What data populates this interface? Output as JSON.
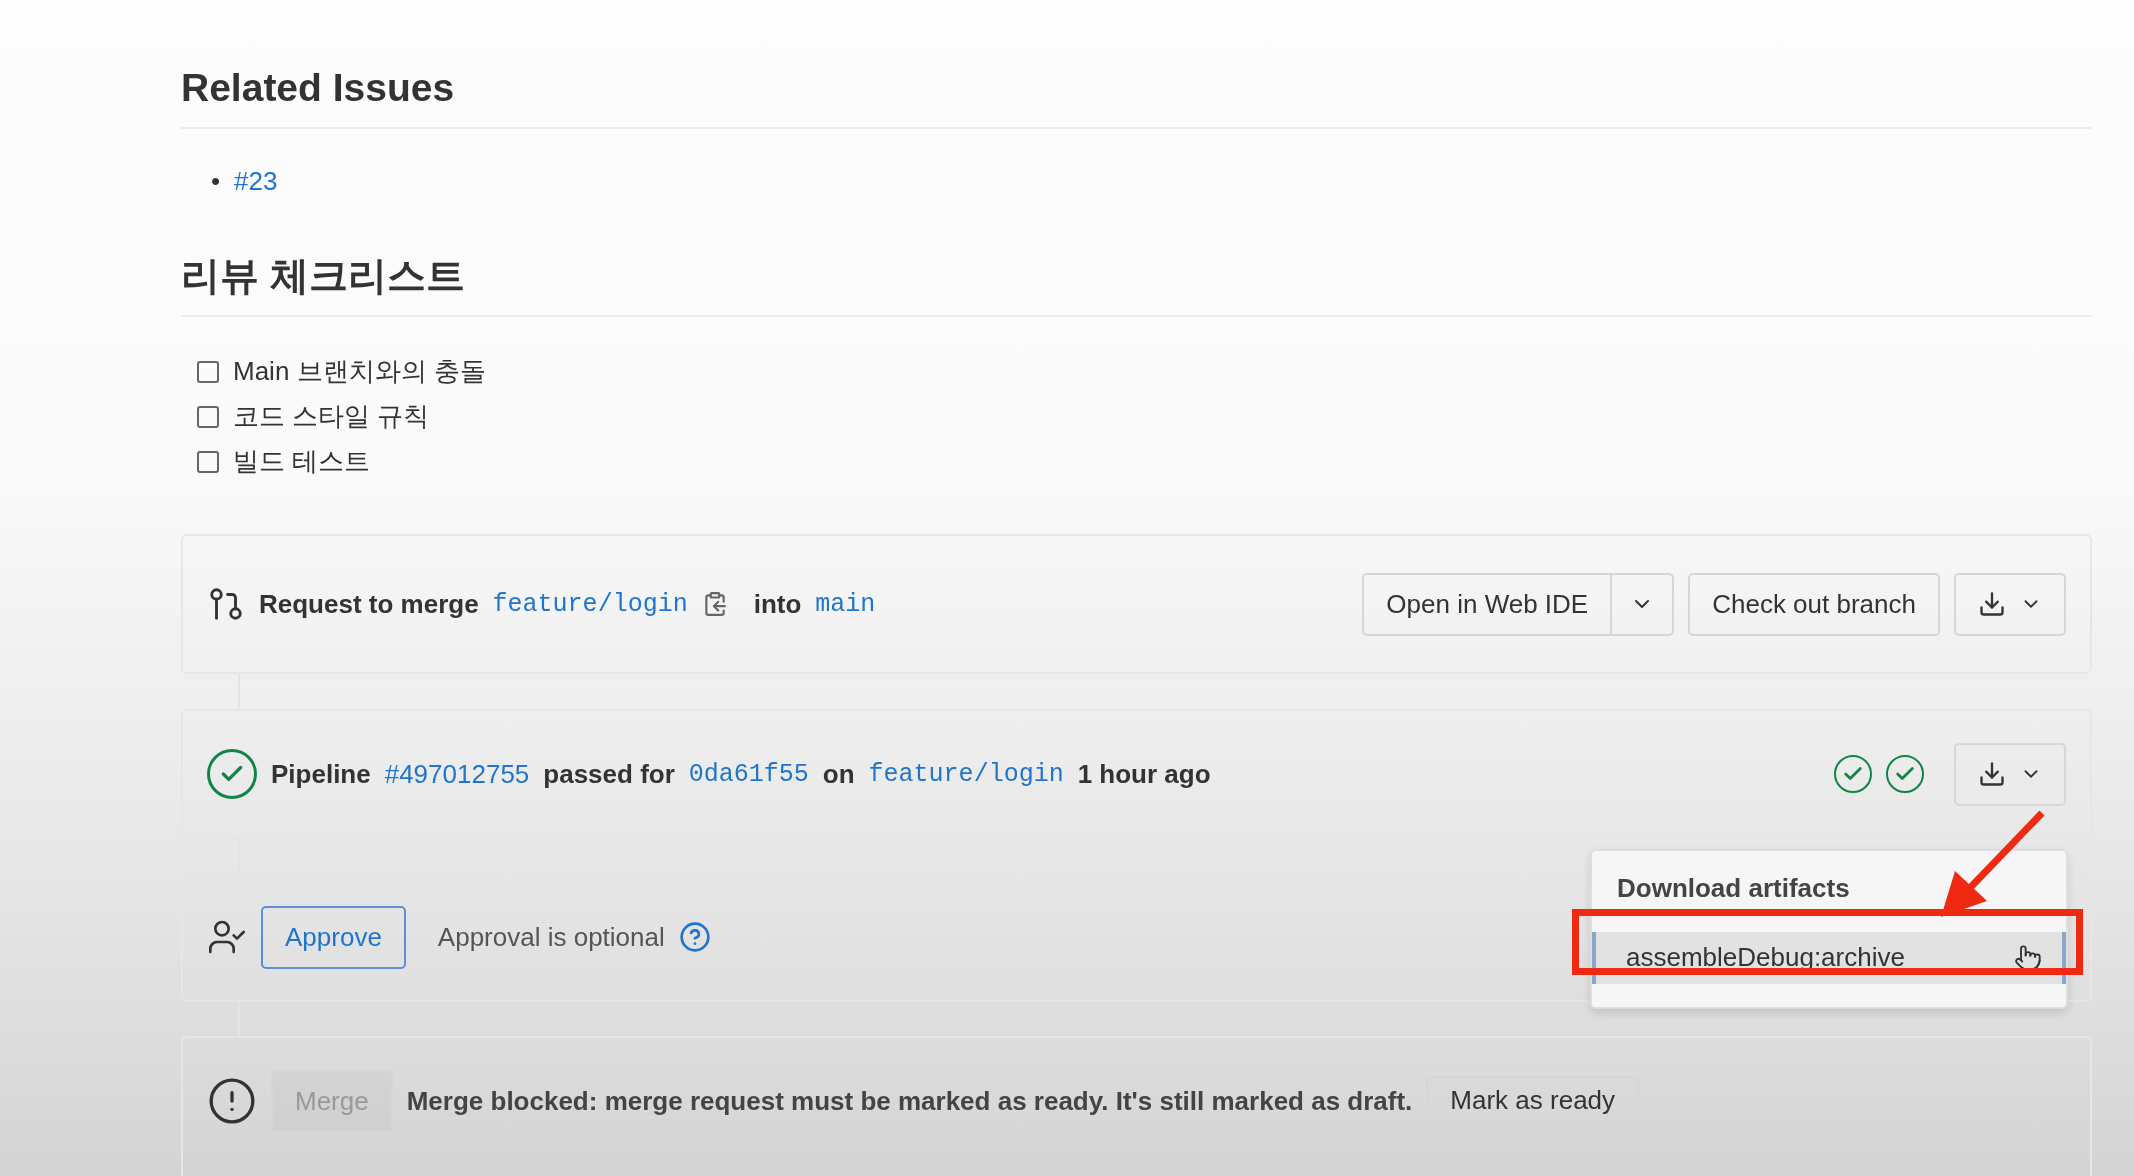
{
  "sections": [
    {
      "kind": "links",
      "title": "Related Issues",
      "items": [
        {
          "marker": "•",
          "text": "#23"
        }
      ]
    },
    {
      "kind": "checklist",
      "title": "리뷰 체크리스트",
      "items": [
        {
          "text": "Main 브랜치와의 충돌",
          "checked": false
        },
        {
          "text": "코드 스타일 규칙",
          "checked": false
        },
        {
          "text": "빌드 테스트",
          "checked": false
        }
      ]
    }
  ],
  "merge_header": {
    "text": "Request to merge",
    "source": "feature/login",
    "into": "into",
    "target": "main",
    "web_ide": "Open in Web IDE",
    "checkout": "Check out branch"
  },
  "pipeline": {
    "label": "Pipeline",
    "id": "#497012755",
    "passed_for": "passed for",
    "commit": "0da61f55",
    "on": "on",
    "branch": "feature/login",
    "time": "1 hour ago",
    "passed": true,
    "stages": [
      {
        "passed": true
      },
      {
        "passed": true
      }
    ],
    "menu": {
      "open": true,
      "header": "Download artifacts",
      "items": [
        {
          "text": "assembleDebug:archive",
          "selected": true
        }
      ]
    }
  },
  "approval": {
    "button": "Approve",
    "text": "Approval is optional"
  },
  "merge": {
    "button": "Merge",
    "disabled": true,
    "message": "Merge blocked: merge request must be marked as ready. It's still marked as draft.",
    "action": "Mark as ready"
  }
}
